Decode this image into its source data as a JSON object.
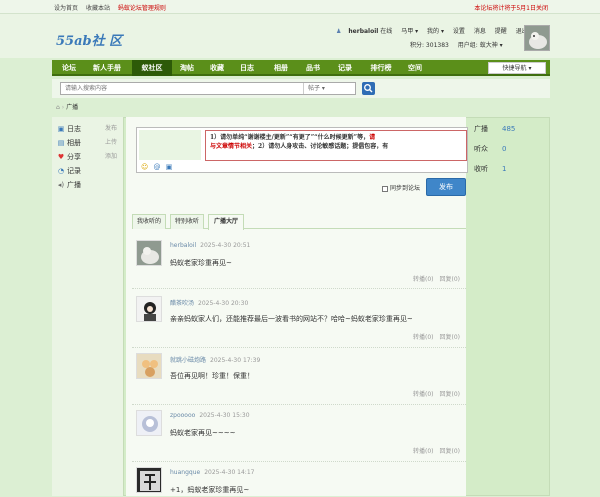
{
  "topbar": {
    "set_home": "设为首页",
    "bookmark": "收藏本站",
    "rules": "蚂蚁论坛管理规则",
    "notice": "本论坛将计将于5月1日关闭"
  },
  "logo": {
    "text": "55ab社 区"
  },
  "user": {
    "name": "herbaloil",
    "status": "在线",
    "links": [
      "马甲 ▾",
      "我的 ▾",
      "设置",
      "消息",
      "提醒",
      "退出"
    ],
    "points_label": "积分: 301383",
    "group_label": "用户组: 蚁大神 ▾"
  },
  "nav": {
    "items": [
      "论坛",
      "新人手册",
      "蚁社区",
      "淘帖",
      "收藏",
      "日志",
      "相册",
      "品书",
      "记录",
      "排行榜",
      "空间"
    ],
    "active_index": 2,
    "quick": "快捷导航 ▾"
  },
  "search": {
    "placeholder": "请输入搜索内容",
    "scope": "帖子 ▾"
  },
  "breadcrumb": {
    "current": "广播"
  },
  "sidebar": {
    "items": [
      {
        "icon": "▣",
        "label": "日志",
        "action": "发布"
      },
      {
        "icon": "▤",
        "label": "相册",
        "action": "上传"
      },
      {
        "icon": "♥",
        "label": "分享",
        "action": "添加"
      },
      {
        "icon": "◔",
        "label": "记录",
        "action": ""
      },
      {
        "icon": "◂)",
        "label": "广播",
        "action": ""
      }
    ]
  },
  "composer": {
    "line1": "1）请勿单纯“谢谢楼主/更新”“有更了”“什么时候更新”等，",
    "line1_red": "请",
    "line2_red": "与文章情节相关",
    "line2": "；2）请勿人身攻击、讨论敏感话题；提倡包容，有",
    "sync_label": "同步到论坛",
    "publish_label": "发布"
  },
  "stats": [
    {
      "label": "广播",
      "value": "485"
    },
    {
      "label": "听众",
      "value": "0"
    },
    {
      "label": "收听",
      "value": "1"
    }
  ],
  "tabs": [
    "我收听的",
    "特别收听",
    "广播大厅"
  ],
  "active_tab": 2,
  "posts": [
    {
      "user": "herbaloil",
      "time": "2025-4-30 20:51",
      "msg": "蚂蚁老家珍重再见~",
      "acts": [
        "转播(0)",
        "回复(0)"
      ]
    },
    {
      "user": "醋茶吹汤",
      "time": "2025-4-30 20:30",
      "msg": "亲亲蚂蚁家人们，还能推荐最后一波看书的网站不？哈哈~蚂蚁老家珍重再见~",
      "acts": [
        "转播(0)",
        "回复(0)"
      ]
    },
    {
      "user": "就跳小磁炮路",
      "time": "2025-4-30 17:39",
      "msg": "吾位再见啊！珍重！保重！",
      "acts": [
        "转播(0)",
        "回复(0)"
      ]
    },
    {
      "user": "zpooooo",
      "time": "2025-4-30 15:30",
      "msg": "蚂蚁老家再见~~~~",
      "acts": [
        "转播(0)",
        "回复(0)"
      ]
    },
    {
      "user": "huangque",
      "time": "2025-4-30 14:17",
      "msg": "+1，蚂蚁老家珍重再见~",
      "acts": []
    }
  ],
  "colors": {
    "nav_green": "#5b8f1a",
    "nav_active": "#2d5a08",
    "page_bg": "#dcefd3",
    "publish_blue": "#3f86c9",
    "accent_red": "#cc0000"
  }
}
